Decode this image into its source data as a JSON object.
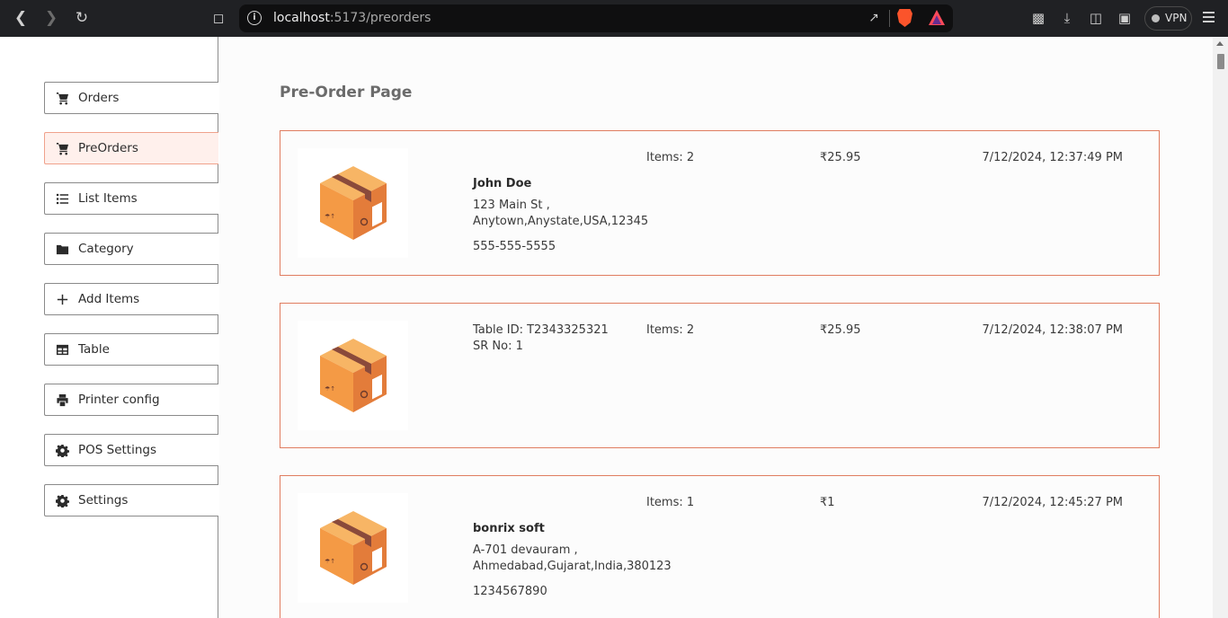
{
  "browser": {
    "url_host": "localhost",
    "url_rest": ":5173/preorders",
    "vpn_label": "VPN"
  },
  "sidebar": {
    "items": [
      {
        "label": "Orders",
        "icon": "cart-icon"
      },
      {
        "label": "PreOrders",
        "icon": "cart-icon",
        "active": true
      },
      {
        "label": "List Items",
        "icon": "list-icon"
      },
      {
        "label": "Category",
        "icon": "folder-icon"
      },
      {
        "label": "Add Items",
        "icon": "plus-icon"
      },
      {
        "label": "Table",
        "icon": "table-icon"
      },
      {
        "label": "Printer config",
        "icon": "printer-icon"
      },
      {
        "label": "POS Settings",
        "icon": "gear-icon"
      },
      {
        "label": "Settings",
        "icon": "gear-icon"
      }
    ]
  },
  "main": {
    "page_title": "Pre-Order Page",
    "orders": [
      {
        "image": "package-box-icon",
        "customer_name": "John Doe",
        "address_line1": "123 Main St ,",
        "address_line2": "Anytown,Anystate,USA,12345",
        "phone": "555-555-5555",
        "items": "Items: 2",
        "price": "₹25.95",
        "date": "7/12/2024, 12:37:49 PM"
      },
      {
        "image": "package-box-icon",
        "table_id": "Table ID: T2343325321",
        "sr_no": "SR No: 1",
        "items": "Items: 2",
        "price": "₹25.95",
        "date": "7/12/2024, 12:38:07 PM"
      },
      {
        "image": "package-box-icon",
        "customer_name": "bonrix soft",
        "address_line1": "A-701 devauram ,",
        "address_line2": "Ahmedabad,Gujarat,India,380123",
        "phone": "1234567890",
        "items": "Items: 1",
        "price": "₹1",
        "date": "7/12/2024, 12:45:27 PM"
      }
    ]
  },
  "colors": {
    "accent_border": "#e07d60",
    "active_bg": "#fff0ec",
    "box_orange": "#f4a04c"
  }
}
